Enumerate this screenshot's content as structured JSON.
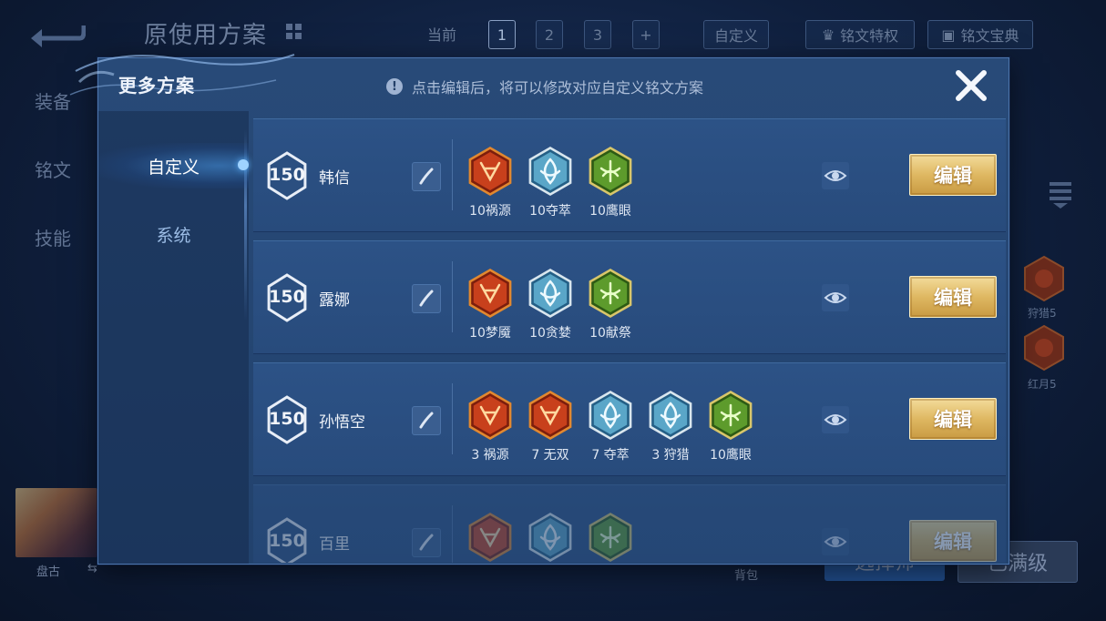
{
  "background": {
    "title": "原使用方案",
    "tabs": [
      {
        "label": "当前"
      },
      {
        "label": "1"
      },
      {
        "label": "2"
      },
      {
        "label": "3"
      },
      {
        "label": "+"
      },
      {
        "label": "自定义"
      },
      {
        "label": "铭文特权"
      },
      {
        "label": "铭文宝典"
      }
    ],
    "side_nav": [
      "装备",
      "铭文",
      "技能"
    ],
    "right_items": [
      "狩猎5",
      "红月5"
    ],
    "hero_name": "盘古",
    "hero_glyph": "⇆",
    "bottom_left_label": "背包",
    "bottom_buttons": [
      "选择师",
      "已满级"
    ]
  },
  "modal": {
    "title": "更多方案",
    "hint": "点击编辑后，将可以修改对应自定义铭文方案",
    "hint_icon": "!",
    "close_icon": "close-icon",
    "nav": [
      {
        "label": "自定义",
        "active": true
      },
      {
        "label": "系统",
        "active": false
      }
    ],
    "rows": [
      {
        "level": "150",
        "hero": "韩信",
        "edit_label": "编辑",
        "runes": [
          {
            "label": "10祸源",
            "color": "red",
            "icon": "rune-red-shield"
          },
          {
            "label": "10夺萃",
            "color": "blue",
            "icon": "rune-blue-knot"
          },
          {
            "label": "10鹰眼",
            "color": "green",
            "icon": "rune-green-clover"
          }
        ]
      },
      {
        "level": "150",
        "hero": "露娜",
        "edit_label": "编辑",
        "runes": [
          {
            "label": "10梦魇",
            "color": "red",
            "icon": "rune-red-wings"
          },
          {
            "label": "10贪婪",
            "color": "blue",
            "icon": "rune-blue-star"
          },
          {
            "label": "10献祭",
            "color": "green",
            "icon": "rune-green-leaf"
          }
        ]
      },
      {
        "level": "150",
        "hero": "孙悟空",
        "edit_label": "编辑",
        "runes": [
          {
            "label": "3 祸源",
            "color": "red",
            "icon": "rune-red-shield"
          },
          {
            "label": "7 无双",
            "color": "red",
            "icon": "rune-red-diamond"
          },
          {
            "label": "7 夺萃",
            "color": "blue",
            "icon": "rune-blue-knot"
          },
          {
            "label": "3 狩猎",
            "color": "blue",
            "icon": "rune-blue-lightning"
          },
          {
            "label": "10鹰眼",
            "color": "green",
            "icon": "rune-green-clover"
          }
        ]
      },
      {
        "level": "150",
        "hero": "百里",
        "edit_label": "编辑",
        "runes": [
          {
            "label": "",
            "color": "red",
            "icon": "rune-red-wings"
          },
          {
            "label": "",
            "color": "blue",
            "icon": "rune-blue-knot"
          },
          {
            "label": "",
            "color": "green",
            "icon": "rune-green-clover"
          }
        ]
      }
    ]
  },
  "colors": {
    "red": "#c8401c",
    "blue": "#5aa6c8",
    "green": "#5d9b2c",
    "gold": "#dfb862"
  }
}
